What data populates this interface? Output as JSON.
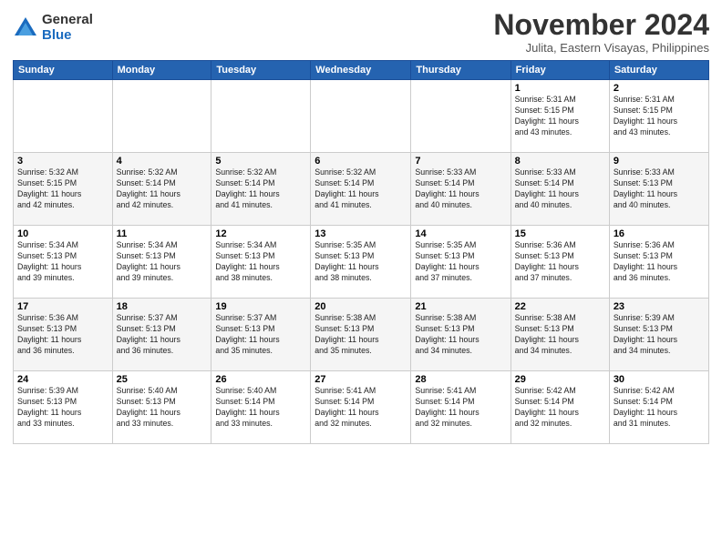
{
  "logo": {
    "general": "General",
    "blue": "Blue"
  },
  "header": {
    "month": "November 2024",
    "location": "Julita, Eastern Visayas, Philippines"
  },
  "weekdays": [
    "Sunday",
    "Monday",
    "Tuesday",
    "Wednesday",
    "Thursday",
    "Friday",
    "Saturday"
  ],
  "weeks": [
    [
      {
        "day": "",
        "info": ""
      },
      {
        "day": "",
        "info": ""
      },
      {
        "day": "",
        "info": ""
      },
      {
        "day": "",
        "info": ""
      },
      {
        "day": "",
        "info": ""
      },
      {
        "day": "1",
        "info": "Sunrise: 5:31 AM\nSunset: 5:15 PM\nDaylight: 11 hours\nand 43 minutes."
      },
      {
        "day": "2",
        "info": "Sunrise: 5:31 AM\nSunset: 5:15 PM\nDaylight: 11 hours\nand 43 minutes."
      }
    ],
    [
      {
        "day": "3",
        "info": "Sunrise: 5:32 AM\nSunset: 5:15 PM\nDaylight: 11 hours\nand 42 minutes."
      },
      {
        "day": "4",
        "info": "Sunrise: 5:32 AM\nSunset: 5:14 PM\nDaylight: 11 hours\nand 42 minutes."
      },
      {
        "day": "5",
        "info": "Sunrise: 5:32 AM\nSunset: 5:14 PM\nDaylight: 11 hours\nand 41 minutes."
      },
      {
        "day": "6",
        "info": "Sunrise: 5:32 AM\nSunset: 5:14 PM\nDaylight: 11 hours\nand 41 minutes."
      },
      {
        "day": "7",
        "info": "Sunrise: 5:33 AM\nSunset: 5:14 PM\nDaylight: 11 hours\nand 40 minutes."
      },
      {
        "day": "8",
        "info": "Sunrise: 5:33 AM\nSunset: 5:14 PM\nDaylight: 11 hours\nand 40 minutes."
      },
      {
        "day": "9",
        "info": "Sunrise: 5:33 AM\nSunset: 5:13 PM\nDaylight: 11 hours\nand 40 minutes."
      }
    ],
    [
      {
        "day": "10",
        "info": "Sunrise: 5:34 AM\nSunset: 5:13 PM\nDaylight: 11 hours\nand 39 minutes."
      },
      {
        "day": "11",
        "info": "Sunrise: 5:34 AM\nSunset: 5:13 PM\nDaylight: 11 hours\nand 39 minutes."
      },
      {
        "day": "12",
        "info": "Sunrise: 5:34 AM\nSunset: 5:13 PM\nDaylight: 11 hours\nand 38 minutes."
      },
      {
        "day": "13",
        "info": "Sunrise: 5:35 AM\nSunset: 5:13 PM\nDaylight: 11 hours\nand 38 minutes."
      },
      {
        "day": "14",
        "info": "Sunrise: 5:35 AM\nSunset: 5:13 PM\nDaylight: 11 hours\nand 37 minutes."
      },
      {
        "day": "15",
        "info": "Sunrise: 5:36 AM\nSunset: 5:13 PM\nDaylight: 11 hours\nand 37 minutes."
      },
      {
        "day": "16",
        "info": "Sunrise: 5:36 AM\nSunset: 5:13 PM\nDaylight: 11 hours\nand 36 minutes."
      }
    ],
    [
      {
        "day": "17",
        "info": "Sunrise: 5:36 AM\nSunset: 5:13 PM\nDaylight: 11 hours\nand 36 minutes."
      },
      {
        "day": "18",
        "info": "Sunrise: 5:37 AM\nSunset: 5:13 PM\nDaylight: 11 hours\nand 36 minutes."
      },
      {
        "day": "19",
        "info": "Sunrise: 5:37 AM\nSunset: 5:13 PM\nDaylight: 11 hours\nand 35 minutes."
      },
      {
        "day": "20",
        "info": "Sunrise: 5:38 AM\nSunset: 5:13 PM\nDaylight: 11 hours\nand 35 minutes."
      },
      {
        "day": "21",
        "info": "Sunrise: 5:38 AM\nSunset: 5:13 PM\nDaylight: 11 hours\nand 34 minutes."
      },
      {
        "day": "22",
        "info": "Sunrise: 5:38 AM\nSunset: 5:13 PM\nDaylight: 11 hours\nand 34 minutes."
      },
      {
        "day": "23",
        "info": "Sunrise: 5:39 AM\nSunset: 5:13 PM\nDaylight: 11 hours\nand 34 minutes."
      }
    ],
    [
      {
        "day": "24",
        "info": "Sunrise: 5:39 AM\nSunset: 5:13 PM\nDaylight: 11 hours\nand 33 minutes."
      },
      {
        "day": "25",
        "info": "Sunrise: 5:40 AM\nSunset: 5:13 PM\nDaylight: 11 hours\nand 33 minutes."
      },
      {
        "day": "26",
        "info": "Sunrise: 5:40 AM\nSunset: 5:14 PM\nDaylight: 11 hours\nand 33 minutes."
      },
      {
        "day": "27",
        "info": "Sunrise: 5:41 AM\nSunset: 5:14 PM\nDaylight: 11 hours\nand 32 minutes."
      },
      {
        "day": "28",
        "info": "Sunrise: 5:41 AM\nSunset: 5:14 PM\nDaylight: 11 hours\nand 32 minutes."
      },
      {
        "day": "29",
        "info": "Sunrise: 5:42 AM\nSunset: 5:14 PM\nDaylight: 11 hours\nand 32 minutes."
      },
      {
        "day": "30",
        "info": "Sunrise: 5:42 AM\nSunset: 5:14 PM\nDaylight: 11 hours\nand 31 minutes."
      }
    ]
  ]
}
